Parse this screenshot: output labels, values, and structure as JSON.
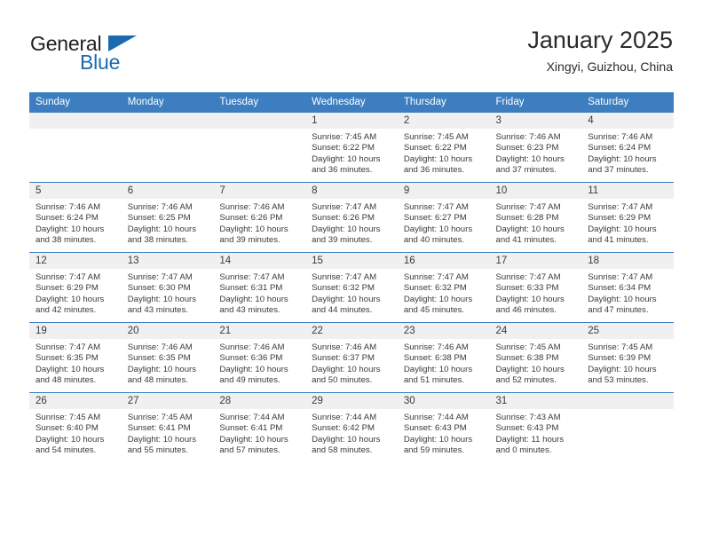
{
  "logo": {
    "line1": "General",
    "line2": "Blue",
    "triangle_color": "#1b6ab0",
    "text_color": "#231f20"
  },
  "header": {
    "title": "January 2025",
    "subtitle": "Xingyi, Guizhou, China"
  },
  "theme": {
    "header_row_bg": "#3c7ebf",
    "header_row_text": "#ffffff",
    "daynum_band_bg": "#f0f0f0",
    "cell_border": "#3c7ebf",
    "body_text": "#3a3a3a"
  },
  "weekday_headers": [
    "Sunday",
    "Monday",
    "Tuesday",
    "Wednesday",
    "Thursday",
    "Friday",
    "Saturday"
  ],
  "labels": {
    "sunrise_prefix": "Sunrise:",
    "sunset_prefix": "Sunset:",
    "daylight_prefix": "Daylight:"
  },
  "weeks": [
    [
      {
        "day": "",
        "sunrise": "",
        "sunset": "",
        "daylight_line1": "",
        "daylight_line2": "",
        "blank": true
      },
      {
        "day": "",
        "sunrise": "",
        "sunset": "",
        "daylight_line1": "",
        "daylight_line2": "",
        "blank": true
      },
      {
        "day": "",
        "sunrise": "",
        "sunset": "",
        "daylight_line1": "",
        "daylight_line2": "",
        "blank": true
      },
      {
        "day": "1",
        "sunrise": "Sunrise: 7:45 AM",
        "sunset": "Sunset: 6:22 PM",
        "daylight_line1": "Daylight: 10 hours",
        "daylight_line2": "and 36 minutes."
      },
      {
        "day": "2",
        "sunrise": "Sunrise: 7:45 AM",
        "sunset": "Sunset: 6:22 PM",
        "daylight_line1": "Daylight: 10 hours",
        "daylight_line2": "and 36 minutes."
      },
      {
        "day": "3",
        "sunrise": "Sunrise: 7:46 AM",
        "sunset": "Sunset: 6:23 PM",
        "daylight_line1": "Daylight: 10 hours",
        "daylight_line2": "and 37 minutes."
      },
      {
        "day": "4",
        "sunrise": "Sunrise: 7:46 AM",
        "sunset": "Sunset: 6:24 PM",
        "daylight_line1": "Daylight: 10 hours",
        "daylight_line2": "and 37 minutes."
      }
    ],
    [
      {
        "day": "5",
        "sunrise": "Sunrise: 7:46 AM",
        "sunset": "Sunset: 6:24 PM",
        "daylight_line1": "Daylight: 10 hours",
        "daylight_line2": "and 38 minutes."
      },
      {
        "day": "6",
        "sunrise": "Sunrise: 7:46 AM",
        "sunset": "Sunset: 6:25 PM",
        "daylight_line1": "Daylight: 10 hours",
        "daylight_line2": "and 38 minutes."
      },
      {
        "day": "7",
        "sunrise": "Sunrise: 7:46 AM",
        "sunset": "Sunset: 6:26 PM",
        "daylight_line1": "Daylight: 10 hours",
        "daylight_line2": "and 39 minutes."
      },
      {
        "day": "8",
        "sunrise": "Sunrise: 7:47 AM",
        "sunset": "Sunset: 6:26 PM",
        "daylight_line1": "Daylight: 10 hours",
        "daylight_line2": "and 39 minutes."
      },
      {
        "day": "9",
        "sunrise": "Sunrise: 7:47 AM",
        "sunset": "Sunset: 6:27 PM",
        "daylight_line1": "Daylight: 10 hours",
        "daylight_line2": "and 40 minutes."
      },
      {
        "day": "10",
        "sunrise": "Sunrise: 7:47 AM",
        "sunset": "Sunset: 6:28 PM",
        "daylight_line1": "Daylight: 10 hours",
        "daylight_line2": "and 41 minutes."
      },
      {
        "day": "11",
        "sunrise": "Sunrise: 7:47 AM",
        "sunset": "Sunset: 6:29 PM",
        "daylight_line1": "Daylight: 10 hours",
        "daylight_line2": "and 41 minutes."
      }
    ],
    [
      {
        "day": "12",
        "sunrise": "Sunrise: 7:47 AM",
        "sunset": "Sunset: 6:29 PM",
        "daylight_line1": "Daylight: 10 hours",
        "daylight_line2": "and 42 minutes."
      },
      {
        "day": "13",
        "sunrise": "Sunrise: 7:47 AM",
        "sunset": "Sunset: 6:30 PM",
        "daylight_line1": "Daylight: 10 hours",
        "daylight_line2": "and 43 minutes."
      },
      {
        "day": "14",
        "sunrise": "Sunrise: 7:47 AM",
        "sunset": "Sunset: 6:31 PM",
        "daylight_line1": "Daylight: 10 hours",
        "daylight_line2": "and 43 minutes."
      },
      {
        "day": "15",
        "sunrise": "Sunrise: 7:47 AM",
        "sunset": "Sunset: 6:32 PM",
        "daylight_line1": "Daylight: 10 hours",
        "daylight_line2": "and 44 minutes."
      },
      {
        "day": "16",
        "sunrise": "Sunrise: 7:47 AM",
        "sunset": "Sunset: 6:32 PM",
        "daylight_line1": "Daylight: 10 hours",
        "daylight_line2": "and 45 minutes."
      },
      {
        "day": "17",
        "sunrise": "Sunrise: 7:47 AM",
        "sunset": "Sunset: 6:33 PM",
        "daylight_line1": "Daylight: 10 hours",
        "daylight_line2": "and 46 minutes."
      },
      {
        "day": "18",
        "sunrise": "Sunrise: 7:47 AM",
        "sunset": "Sunset: 6:34 PM",
        "daylight_line1": "Daylight: 10 hours",
        "daylight_line2": "and 47 minutes."
      }
    ],
    [
      {
        "day": "19",
        "sunrise": "Sunrise: 7:47 AM",
        "sunset": "Sunset: 6:35 PM",
        "daylight_line1": "Daylight: 10 hours",
        "daylight_line2": "and 48 minutes."
      },
      {
        "day": "20",
        "sunrise": "Sunrise: 7:46 AM",
        "sunset": "Sunset: 6:35 PM",
        "daylight_line1": "Daylight: 10 hours",
        "daylight_line2": "and 48 minutes."
      },
      {
        "day": "21",
        "sunrise": "Sunrise: 7:46 AM",
        "sunset": "Sunset: 6:36 PM",
        "daylight_line1": "Daylight: 10 hours",
        "daylight_line2": "and 49 minutes."
      },
      {
        "day": "22",
        "sunrise": "Sunrise: 7:46 AM",
        "sunset": "Sunset: 6:37 PM",
        "daylight_line1": "Daylight: 10 hours",
        "daylight_line2": "and 50 minutes."
      },
      {
        "day": "23",
        "sunrise": "Sunrise: 7:46 AM",
        "sunset": "Sunset: 6:38 PM",
        "daylight_line1": "Daylight: 10 hours",
        "daylight_line2": "and 51 minutes."
      },
      {
        "day": "24",
        "sunrise": "Sunrise: 7:45 AM",
        "sunset": "Sunset: 6:38 PM",
        "daylight_line1": "Daylight: 10 hours",
        "daylight_line2": "and 52 minutes."
      },
      {
        "day": "25",
        "sunrise": "Sunrise: 7:45 AM",
        "sunset": "Sunset: 6:39 PM",
        "daylight_line1": "Daylight: 10 hours",
        "daylight_line2": "and 53 minutes."
      }
    ],
    [
      {
        "day": "26",
        "sunrise": "Sunrise: 7:45 AM",
        "sunset": "Sunset: 6:40 PM",
        "daylight_line1": "Daylight: 10 hours",
        "daylight_line2": "and 54 minutes."
      },
      {
        "day": "27",
        "sunrise": "Sunrise: 7:45 AM",
        "sunset": "Sunset: 6:41 PM",
        "daylight_line1": "Daylight: 10 hours",
        "daylight_line2": "and 55 minutes."
      },
      {
        "day": "28",
        "sunrise": "Sunrise: 7:44 AM",
        "sunset": "Sunset: 6:41 PM",
        "daylight_line1": "Daylight: 10 hours",
        "daylight_line2": "and 57 minutes."
      },
      {
        "day": "29",
        "sunrise": "Sunrise: 7:44 AM",
        "sunset": "Sunset: 6:42 PM",
        "daylight_line1": "Daylight: 10 hours",
        "daylight_line2": "and 58 minutes."
      },
      {
        "day": "30",
        "sunrise": "Sunrise: 7:44 AM",
        "sunset": "Sunset: 6:43 PM",
        "daylight_line1": "Daylight: 10 hours",
        "daylight_line2": "and 59 minutes."
      },
      {
        "day": "31",
        "sunrise": "Sunrise: 7:43 AM",
        "sunset": "Sunset: 6:43 PM",
        "daylight_line1": "Daylight: 11 hours",
        "daylight_line2": "and 0 minutes."
      },
      {
        "day": "",
        "sunrise": "",
        "sunset": "",
        "daylight_line1": "",
        "daylight_line2": "",
        "blank": true
      }
    ]
  ]
}
